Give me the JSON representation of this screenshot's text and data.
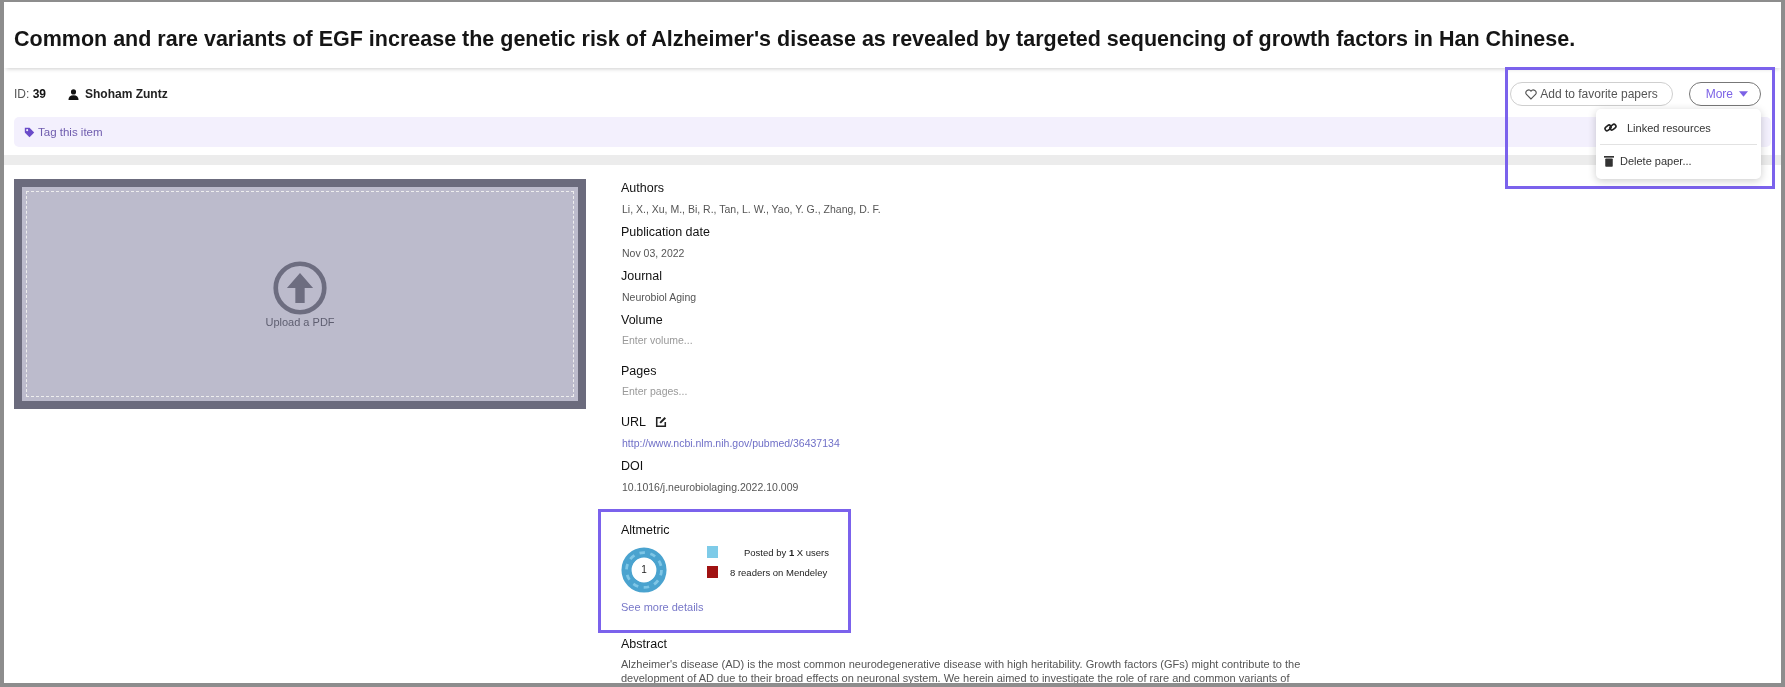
{
  "title": "Common and rare variants of EGF increase the genetic risk of Alzheimer's disease as revealed by targeted sequencing of growth factors in Han Chinese.",
  "id_label": "ID:",
  "id_value": "39",
  "owner": "Shoham Zuntz",
  "tag_prompt": "Tag this item",
  "actions": {
    "favorite": "Add to favorite papers",
    "more": "More",
    "expanded": true
  },
  "menu": [
    {
      "kind": "link",
      "label": "Linked resources"
    },
    {
      "kind": "delete",
      "label": "Delete paper..."
    }
  ],
  "upload": {
    "label": "Upload a PDF"
  },
  "fields": [
    {
      "label": "Authors",
      "kind": "text",
      "editable": false,
      "value": "Li, X., Xu, M., Bi, R., Tan, L. W., Yao, Y. G., Zhang, D. F."
    },
    {
      "label": "Publication date",
      "kind": "text",
      "editable": false,
      "value": "Nov 03, 2022"
    },
    {
      "label": "Journal",
      "kind": "text",
      "editable": false,
      "value": "Neurobiol Aging"
    },
    {
      "label": "Volume",
      "kind": "input",
      "editable": false,
      "placeholder": "Enter volume..."
    },
    {
      "label": "Pages",
      "kind": "input",
      "editable": false,
      "placeholder": "Enter pages..."
    },
    {
      "label": "URL",
      "kind": "link",
      "editable": true,
      "value": "http://www.ncbi.nlm.nih.gov/pubmed/36437134"
    },
    {
      "label": "DOI",
      "kind": "text",
      "editable": false,
      "value": "10.1016/j.neurobiolaging.2022.10.009"
    }
  ],
  "altmetric": {
    "label": "Altmetric",
    "score": "1",
    "details_link": "See more details",
    "legend": [
      {
        "text": "Posted by **1** X users",
        "color": "#7ecbe8"
      },
      {
        "text": "8 readers on Mendeley",
        "color": "#a01212"
      }
    ]
  },
  "abstract": {
    "label": "Abstract",
    "lines": [
      "Alzheimer's disease (AD) is the most common neurodegenerative disease with high heritability. Growth factors (GFs) might contribute to the",
      "development of AD due to their broad effects on neuronal system. We herein aimed to investigate the role of rare and common variants of"
    ]
  }
}
